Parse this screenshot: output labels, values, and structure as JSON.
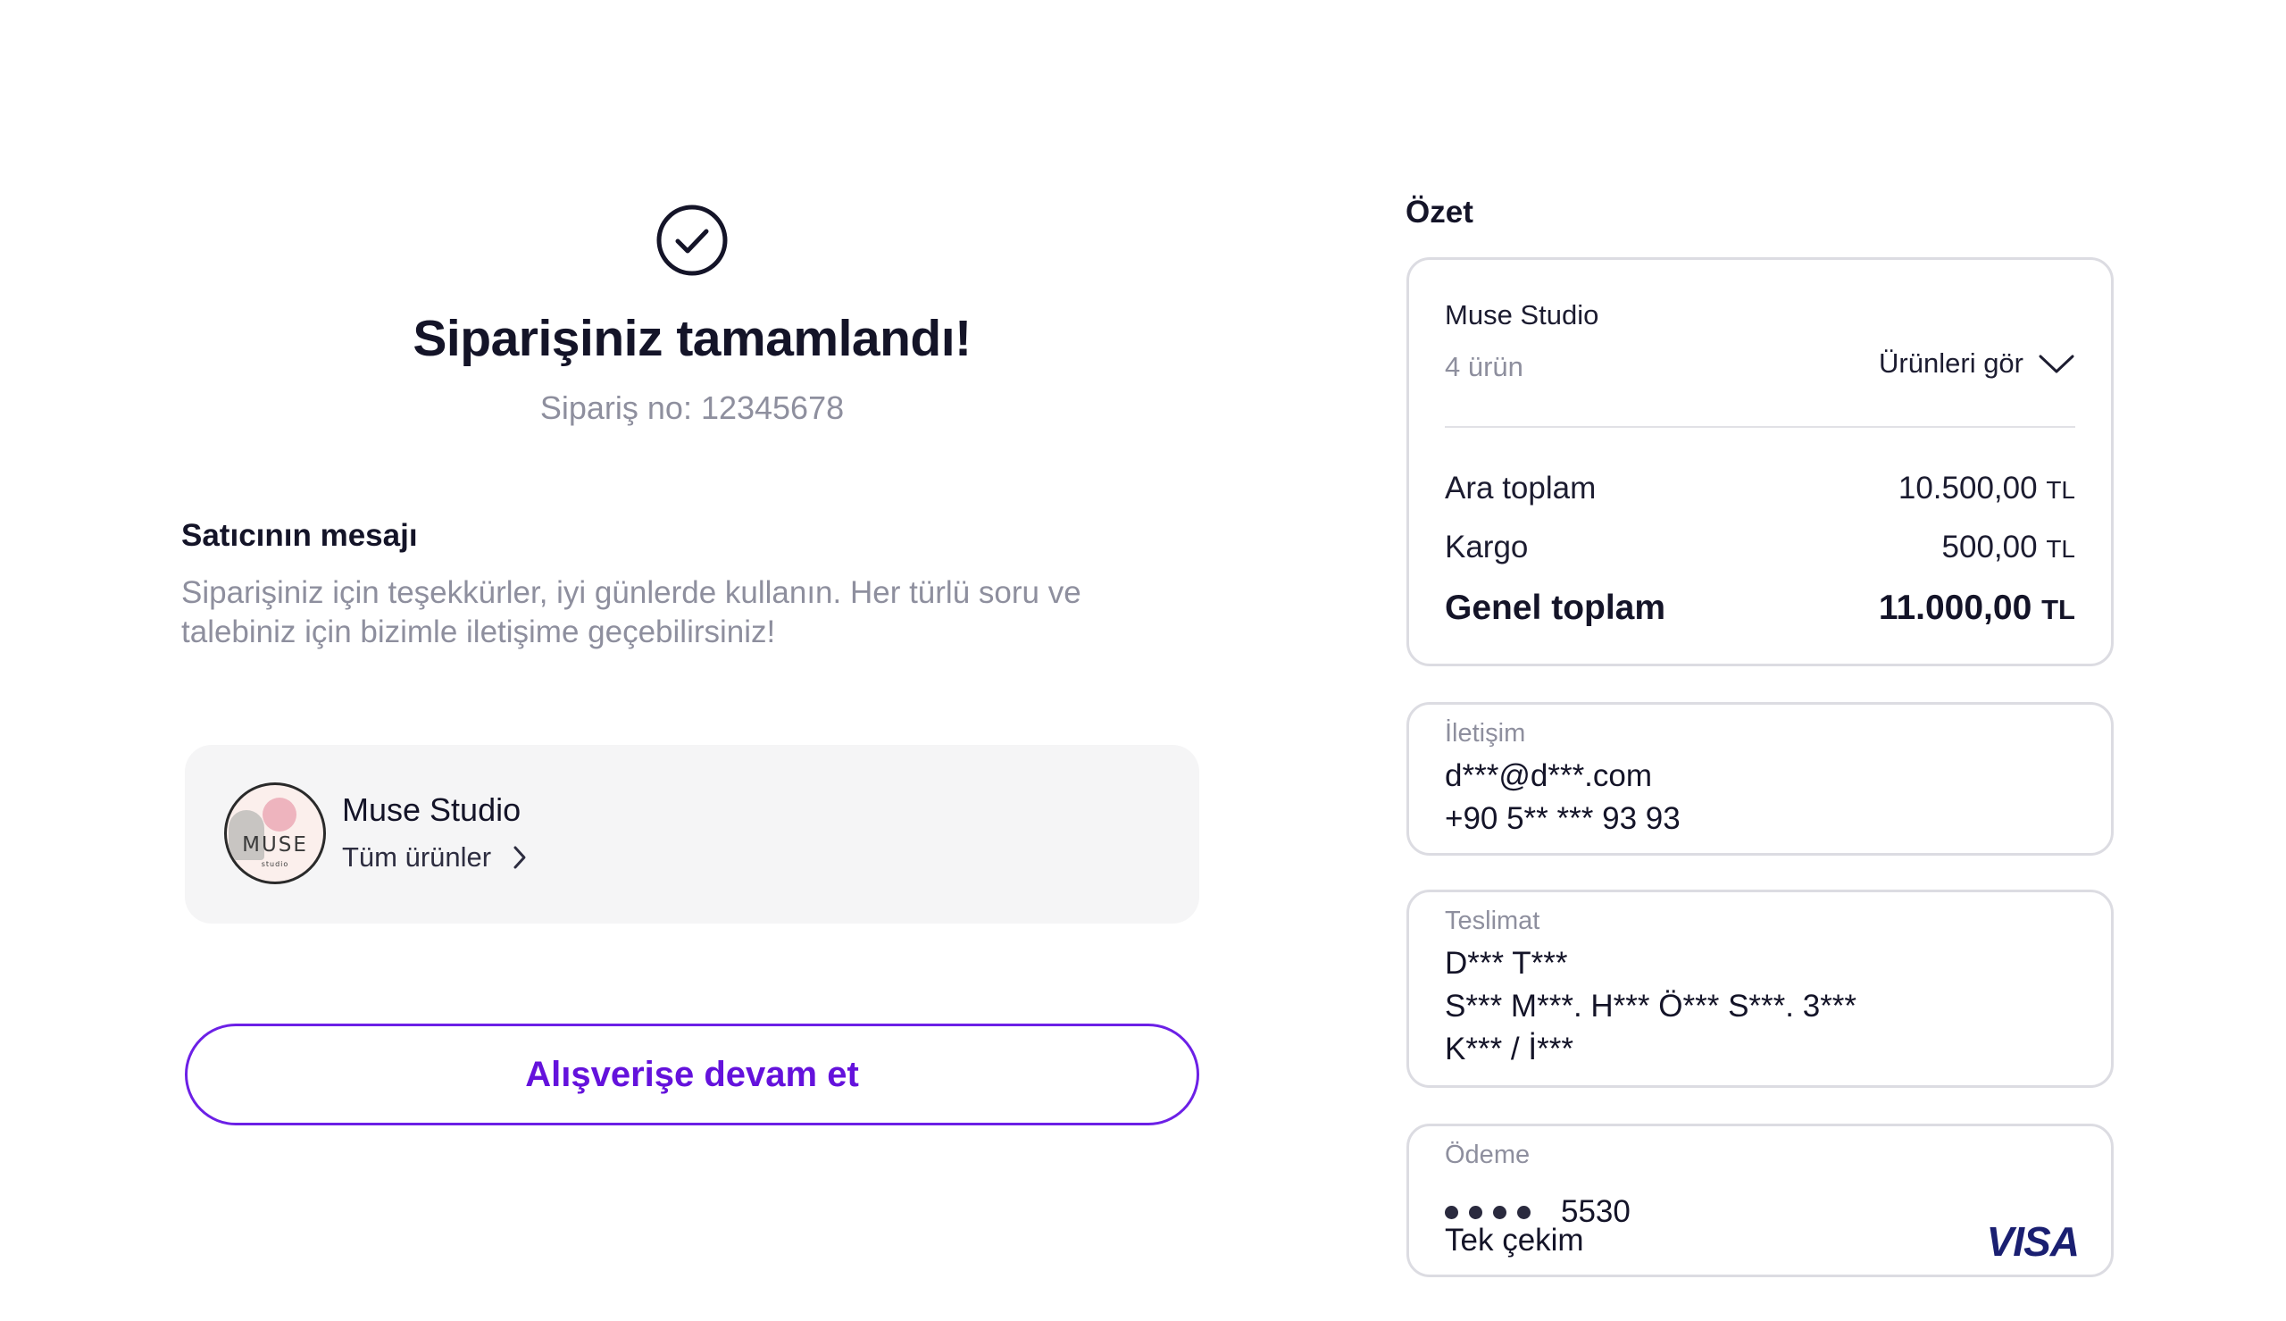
{
  "confirmation": {
    "title": "Siparişiniz tamamlandı!",
    "order_no": "Sipariş no: 12345678"
  },
  "seller_message": {
    "title": "Satıcının mesajı",
    "body": "Siparişiniz için teşekkürler, iyi günlerde kullanın. Her türlü soru ve talebiniz için bizimle iletişime geçebilirsiniz!"
  },
  "seller": {
    "name": "Muse Studio",
    "link_label": "Tüm ürünler",
    "logo_main": "MUSE",
    "logo_sub": "studio"
  },
  "cta": {
    "label": "Alışverişe devam et"
  },
  "summary": {
    "heading": "Özet",
    "shop": "Muse Studio",
    "count": "4 ürün",
    "toggle": "Ürünleri gör",
    "rows": [
      {
        "label": "Ara toplam",
        "value": "10.500,00",
        "currency": "TL"
      },
      {
        "label": "Kargo",
        "value": "500,00",
        "currency": "TL"
      },
      {
        "label": "Genel toplam",
        "value": "11.000,00",
        "currency": "TL"
      }
    ]
  },
  "contact": {
    "label": "İletişim",
    "email": "d***@d***.com",
    "phone": "+90 5** *** 93 93"
  },
  "delivery": {
    "label": "Teslimat",
    "name": "D*** T***",
    "address": "S*** M***. H*** Ö*** S***. 3***",
    "city": "K*** / İ***"
  },
  "payment": {
    "label": "Ödeme",
    "card_last4": "5530",
    "installment": "Tek çekim",
    "brand": "VISA"
  },
  "colors": {
    "accent": "#6412dc",
    "text": "#141428",
    "muted": "#8e8f9e",
    "card_border": "#dcdce2",
    "seller_card_bg": "#f5f5f6"
  }
}
